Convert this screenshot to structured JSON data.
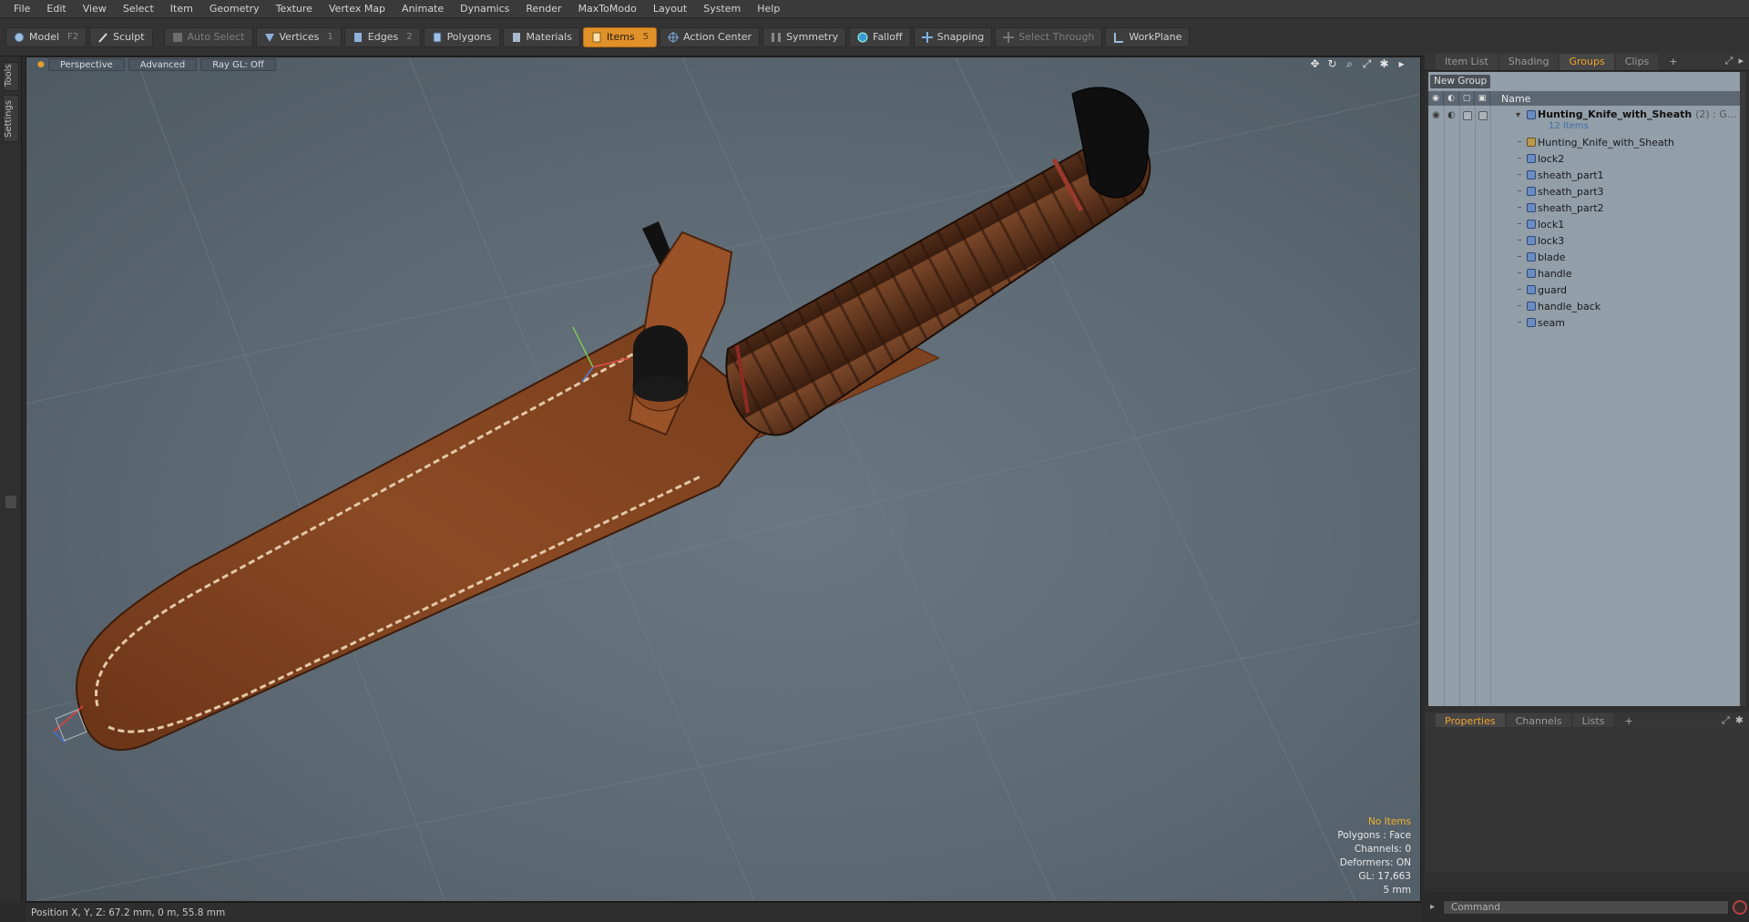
{
  "menu": [
    "File",
    "Edit",
    "View",
    "Select",
    "Item",
    "Geometry",
    "Texture",
    "Vertex Map",
    "Animate",
    "Dynamics",
    "Render",
    "MaxToModo",
    "Layout",
    "System",
    "Help"
  ],
  "toolbar": {
    "model": "Model",
    "model_hotkey": "F2",
    "sculpt": "Sculpt",
    "auto_select": "Auto Select",
    "vertices": "Vertices",
    "vertices_hotkey": "1",
    "edges": "Edges",
    "edges_hotkey": "2",
    "polygons": "Polygons",
    "materials": "Materials",
    "items": "Items",
    "items_hotkey": "5",
    "action_center": "Action Center",
    "symmetry": "Symmetry",
    "falloff": "Falloff",
    "snapping": "Snapping",
    "select_through": "Select Through",
    "workplane": "WorkPlane",
    "active_color": "#e0912a"
  },
  "left_tabs": [
    "Tools",
    "Settings"
  ],
  "viewport": {
    "view_mode": "Perspective",
    "shading": "Advanced",
    "raygl": "Ray GL: Off",
    "icons": [
      "move-view-icon",
      "rotate-view-icon",
      "zoom-view-icon",
      "maximize-icon",
      "settings-icon",
      "arrow-right-icon"
    ],
    "info": {
      "no_items": "No Items",
      "polygons": "Polygons : Face",
      "channels": "Channels: 0",
      "deformers": "Deformers: ON",
      "gl": "GL: 17,663",
      "unit": "5 mm"
    }
  },
  "status": {
    "position": "Position X, Y, Z:   67.2 mm, 0 m, 55.8 mm"
  },
  "right_panel": {
    "tabs": [
      "Item List",
      "Shading",
      "Groups",
      "Clips"
    ],
    "selected_tab": "Groups",
    "new_group": "New Group",
    "column_name": "Name",
    "group": {
      "name": "Hunting_Knife_with_Sheath",
      "suffix": "(2) : G...",
      "count": "12 Items"
    },
    "items": [
      "Hunting_Knife_with_Sheath",
      "lock2",
      "sheath_part1",
      "sheath_part3",
      "sheath_part2",
      "lock1",
      "lock3",
      "blade",
      "handle",
      "guard",
      "handle_back",
      "seam"
    ],
    "bottom_tabs": [
      "Properties",
      "Channels",
      "Lists"
    ],
    "command_placeholder": "Command"
  }
}
